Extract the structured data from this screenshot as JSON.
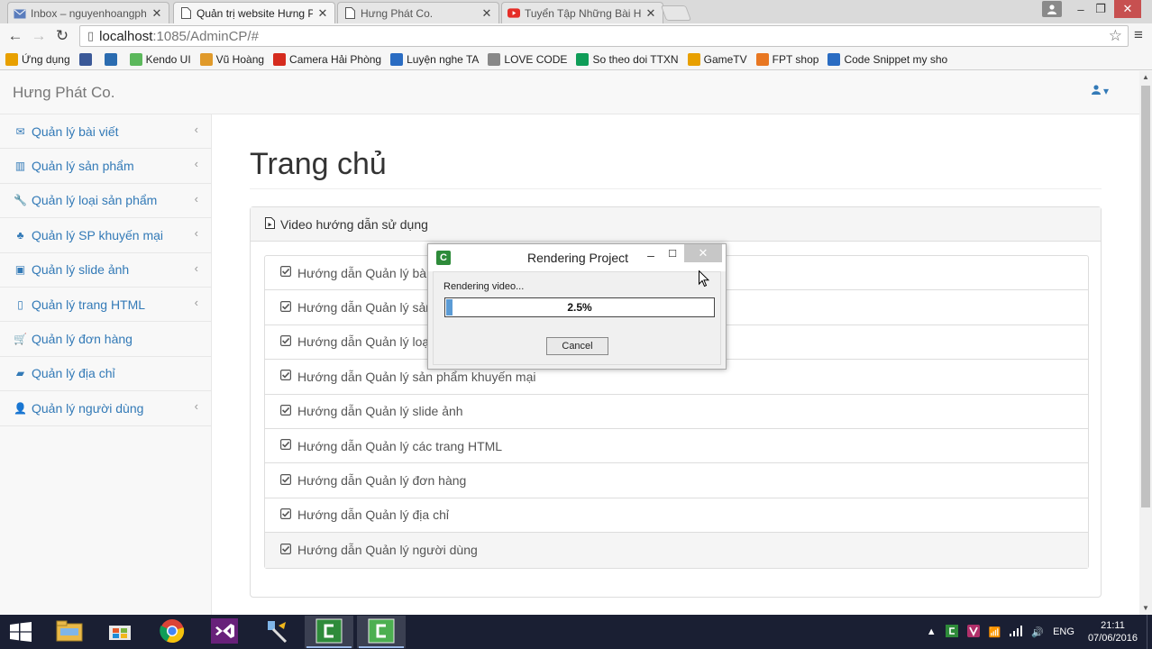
{
  "browser": {
    "tabs": [
      {
        "title": "Inbox – nguyenhoangphu",
        "icon": "mail-icon",
        "active": false
      },
      {
        "title": "Quản trị website Hưng Ph",
        "icon": "page-icon",
        "active": true
      },
      {
        "title": "Hưng Phát Co.",
        "icon": "page-icon",
        "active": false
      },
      {
        "title": "Tuyển Tập Những Bài Hát",
        "icon": "youtube-icon",
        "active": false
      }
    ],
    "url_host": "localhost",
    "url_path": ":1085/AdminCP/#",
    "bookmarks": [
      {
        "label": "Ứng dụng",
        "icon": "apps-icon",
        "color": "#e8a000"
      },
      {
        "label": "",
        "icon": "facebook-icon",
        "color": "#3b5998"
      },
      {
        "label": "",
        "icon": "mail-icon",
        "color": "#2b6cb0"
      },
      {
        "label": "Kendo UI",
        "icon": "kendo-icon",
        "color": "#5cb85c"
      },
      {
        "label": "Vũ Hoàng",
        "icon": "person-icon",
        "color": "#e09a2b"
      },
      {
        "label": "Camera Hải Phòng",
        "icon": "camera-logo-icon",
        "color": "#d52b1e"
      },
      {
        "label": "Luyện nghe TA",
        "icon": "globe-icon",
        "color": "#2a6cc2"
      },
      {
        "label": "LOVE CODE",
        "icon": "page-icon",
        "color": "#888888"
      },
      {
        "label": "So theo doi TTXN",
        "icon": "sheets-icon",
        "color": "#0f9d58"
      },
      {
        "label": "GameTV",
        "icon": "gametv-icon",
        "color": "#e8a000"
      },
      {
        "label": "FPT shop",
        "icon": "fpt-icon",
        "color": "#e87722"
      },
      {
        "label": "Code Snippet my sho",
        "icon": "codesnippet-icon",
        "color": "#2a6cc2"
      }
    ]
  },
  "app": {
    "brand": "Hưng Phát Co.",
    "sidebar": [
      {
        "label": "Quản lý bài viết",
        "icon": "envelope-icon",
        "glyph": "✉",
        "chevron": true
      },
      {
        "label": "Quản lý sản phẩm",
        "icon": "bar-chart-icon",
        "glyph": "▥",
        "chevron": true
      },
      {
        "label": "Quản lý loại sản phẩm",
        "icon": "wrench-icon",
        "glyph": "🔧",
        "chevron": true
      },
      {
        "label": "Quản lý SP khuyến mại",
        "icon": "sitemap-icon",
        "glyph": "♣",
        "chevron": true
      },
      {
        "label": "Quản lý slide ảnh",
        "icon": "image-icon",
        "glyph": "▣",
        "chevron": true
      },
      {
        "label": "Quản lý trang HTML",
        "icon": "file-icon",
        "glyph": "▯",
        "chevron": true
      },
      {
        "label": "Quản lý đơn hàng",
        "icon": "cart-icon",
        "glyph": "🛒",
        "chevron": false
      },
      {
        "label": "Quản lý địa chỉ",
        "icon": "book-icon",
        "glyph": "▰",
        "chevron": false
      },
      {
        "label": "Quản lý người dùng",
        "icon": "user-icon",
        "glyph": "👤",
        "chevron": true
      }
    ],
    "page_title": "Trang chủ",
    "panel_title": "Video hướng dẫn sử dụng",
    "guide_items": [
      "Hướng dẫn Quản lý bài viết",
      "Hướng dẫn Quản lý sản phẩm",
      "Hướng dẫn Quản lý loại sản phẩm",
      "Hướng dẫn Quản lý sản phẩm khuyến mại",
      "Hướng dẫn Quản lý slide ảnh",
      "Hướng dẫn Quản lý các trang HTML",
      "Hướng dẫn Quản lý đơn hàng",
      "Hướng dẫn Quản lý địa chỉ",
      "Hướng dẫn Quản lý người dùng"
    ]
  },
  "dialog": {
    "title": "Rendering Project",
    "status": "Rendering video...",
    "progress_percent": 2.5,
    "progress_label": "2.5%",
    "cancel_label": "Cancel"
  },
  "taskbar": {
    "apps": [
      {
        "name": "file-explorer",
        "icon": "folder-icon",
        "active": false
      },
      {
        "name": "store",
        "icon": "store-icon",
        "active": false
      },
      {
        "name": "chrome",
        "icon": "chrome-icon",
        "active": false
      },
      {
        "name": "visual-studio",
        "icon": "visual-studio-icon",
        "active": false
      },
      {
        "name": "tool",
        "icon": "tool-icon",
        "active": false
      },
      {
        "name": "camtasia-1",
        "icon": "camtasia-icon",
        "active": true
      },
      {
        "name": "camtasia-2",
        "icon": "camtasia-icon",
        "active": true
      }
    ],
    "language": "ENG",
    "time": "21:11",
    "date": "07/06/2016"
  },
  "colors": {
    "link": "#337ab7",
    "progress": "#5b9bd5",
    "taskbar": "#1a1f33"
  }
}
